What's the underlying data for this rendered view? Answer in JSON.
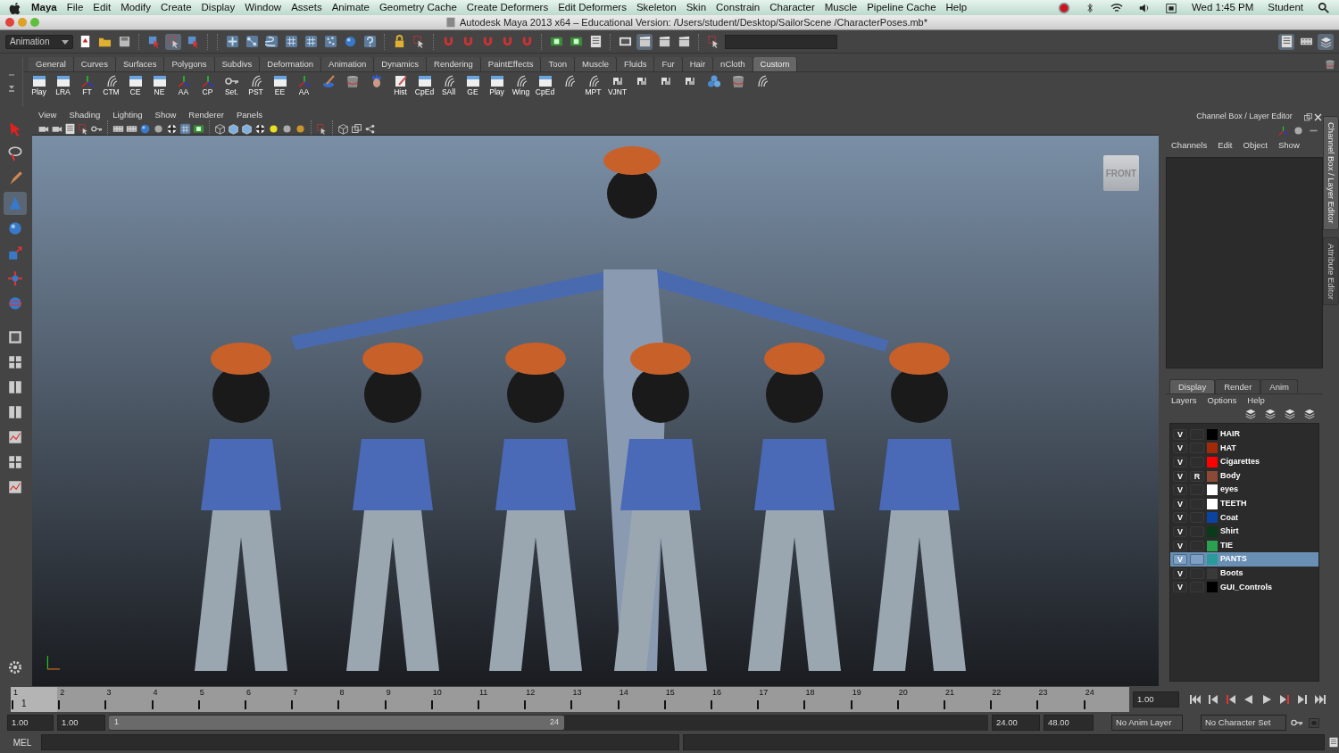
{
  "menubar": {
    "app": "Maya",
    "items": [
      "File",
      "Edit",
      "Modify",
      "Create",
      "Display",
      "Window",
      "Assets",
      "Animate",
      "Geometry Cache",
      "Create Deformers",
      "Edit Deformers",
      "Skeleton",
      "Skin",
      "Constrain",
      "Character",
      "Muscle",
      "Pipeline Cache",
      "Help"
    ],
    "clock": "Wed 1:45 PM",
    "user": "Student"
  },
  "window": {
    "title": "Autodesk Maya 2013 x64 – Educational Version: /Users/student/Desktop/SailorScene /CharacterPoses.mb*"
  },
  "status_line": {
    "mode": "Animation"
  },
  "shelf": {
    "tabs": [
      {
        "label": "General",
        "selected": false
      },
      {
        "label": "Curves",
        "selected": false
      },
      {
        "label": "Surfaces",
        "selected": false
      },
      {
        "label": "Polygons",
        "selected": false
      },
      {
        "label": "Subdivs",
        "selected": false
      },
      {
        "label": "Deformation",
        "selected": false
      },
      {
        "label": "Animation",
        "selected": false
      },
      {
        "label": "Dynamics",
        "selected": false
      },
      {
        "label": "Rendering",
        "selected": false
      },
      {
        "label": "PaintEffects",
        "selected": false
      },
      {
        "label": "Toon",
        "selected": false
      },
      {
        "label": "Muscle",
        "selected": false
      },
      {
        "label": "Fluids",
        "selected": false
      },
      {
        "label": "Fur",
        "selected": false
      },
      {
        "label": "Hair",
        "selected": false
      },
      {
        "label": "nCloth",
        "selected": false
      },
      {
        "label": "Custom",
        "selected": true
      }
    ],
    "buttons": [
      {
        "kind": "labeled",
        "label": "Play"
      },
      {
        "kind": "labeled",
        "label": "LRA"
      },
      {
        "kind": "labeled",
        "label": "FT"
      },
      {
        "kind": "labeled",
        "label": "CTM"
      },
      {
        "kind": "labeled",
        "label": "CE"
      },
      {
        "kind": "labeled",
        "label": "NE"
      },
      {
        "kind": "labeled",
        "label": "AA"
      },
      {
        "kind": "labeled",
        "label": "CP"
      },
      {
        "kind": "labeled",
        "label": "Set."
      },
      {
        "kind": "labeled",
        "label": "PST"
      },
      {
        "kind": "labeled",
        "label": "EE"
      },
      {
        "kind": "labeled",
        "label": "AA"
      },
      {
        "kind": "plain"
      },
      {
        "kind": "plain"
      },
      {
        "kind": "plain"
      },
      {
        "kind": "labeled",
        "label": "Hist"
      },
      {
        "kind": "labeled",
        "label": "CpEd"
      },
      {
        "kind": "labeled",
        "label": "SAll"
      },
      {
        "kind": "labeled",
        "label": "GE"
      },
      {
        "kind": "labeled",
        "label": "Play"
      },
      {
        "kind": "labeled",
        "label": "Wing"
      },
      {
        "kind": "labeled",
        "label": "CpEd"
      },
      {
        "kind": "plain"
      },
      {
        "kind": "labeled",
        "label": "MPT"
      },
      {
        "kind": "labeled",
        "label": "VJNT"
      },
      {
        "kind": "plain"
      },
      {
        "kind": "plain"
      },
      {
        "kind": "plain"
      },
      {
        "kind": "plain"
      },
      {
        "kind": "plain"
      },
      {
        "kind": "plain"
      }
    ]
  },
  "viewport": {
    "menus": [
      "View",
      "Shading",
      "Lighting",
      "Show",
      "Renderer",
      "Panels"
    ],
    "view_cube": "FRONT"
  },
  "channel_box": {
    "title": "Channel Box / Layer Editor",
    "menus": [
      "Channels",
      "Edit",
      "Object",
      "Show"
    ]
  },
  "layer_editor": {
    "tabs": [
      {
        "label": "Display",
        "selected": true
      },
      {
        "label": "Render",
        "selected": false
      },
      {
        "label": "Anim",
        "selected": false
      }
    ],
    "menus": [
      "Layers",
      "Options",
      "Help"
    ],
    "layers": [
      {
        "v": "V",
        "name": "HAIR",
        "color": "#000000",
        "selected": false
      },
      {
        "v": "V",
        "name": "HAT",
        "color": "#a02a0a",
        "selected": false
      },
      {
        "v": "V",
        "name": "Cigarettes",
        "color": "#ff0000",
        "selected": false
      },
      {
        "v": "V",
        "r": "R",
        "name": "Body",
        "color": "#8a4a35",
        "selected": false
      },
      {
        "v": "V",
        "name": "eyes",
        "color": "#ffffff",
        "selected": false
      },
      {
        "v": "V",
        "name": "TEETH",
        "color": "#ffffff",
        "selected": false
      },
      {
        "v": "V",
        "name": "Coat",
        "color": "#0a44a0",
        "selected": false
      },
      {
        "v": "V",
        "name": "Shirt",
        "color": "#0a3a1a",
        "selected": false
      },
      {
        "v": "V",
        "name": "TIE",
        "color": "#2aa050",
        "selected": false
      },
      {
        "v": "V",
        "name": "PANTS",
        "color": "#2a9a9a",
        "selected": true
      },
      {
        "v": "V",
        "name": "Boots",
        "color": "#3a3a3a",
        "selected": false
      },
      {
        "v": "V",
        "name": "GUI_Controls",
        "color": "#000000",
        "selected": false
      }
    ]
  },
  "side_tabs": [
    {
      "label": "Channel Box / Layer Editor",
      "selected": true
    },
    {
      "label": "Attribute Editor",
      "selected": false
    }
  ],
  "time_slider": {
    "frames": [
      "1",
      "2",
      "3",
      "4",
      "5",
      "6",
      "7",
      "8",
      "9",
      "10",
      "11",
      "12",
      "13",
      "14",
      "15",
      "16",
      "17",
      "18",
      "19",
      "20",
      "21",
      "22",
      "23",
      "24"
    ],
    "current_frame": "1",
    "current_time": "1.00"
  },
  "range_slider": {
    "start": "1.00",
    "range_start": "1.00",
    "handle_start": "1",
    "handle_end": "24",
    "range_end": "24.00",
    "end": "48.00",
    "anim_layer": "No Anim Layer",
    "character_set": "No Character Set"
  },
  "command_line": {
    "label": "MEL"
  }
}
